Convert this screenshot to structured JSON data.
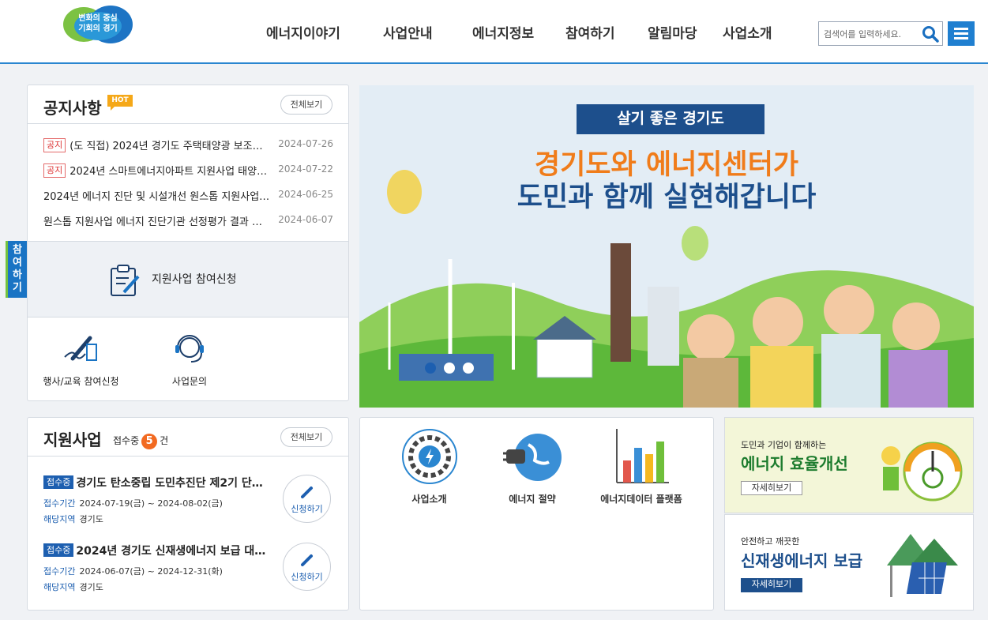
{
  "header": {
    "logo_line1": "변화의 중심",
    "logo_line2": "기회의 경기",
    "nav": [
      "에너지이야기",
      "사업안내",
      "에너지정보",
      "참여하기",
      "알림마당",
      "사업소개"
    ],
    "search_placeholder": "검색어를 입력하세요."
  },
  "side_tab": {
    "chars": [
      "참",
      "여",
      "하",
      "기"
    ]
  },
  "notice": {
    "title": "공지사항",
    "hot": "HOT",
    "more": "전체보기",
    "items": [
      {
        "tag": "공지",
        "text": "(도 직접) 2024년 경기도 주택태양광 보조…",
        "date": "2024-07-26"
      },
      {
        "tag": "공지",
        "text": "2024년 스마트에너지아파트 지원사업 태양…",
        "date": "2024-07-22"
      },
      {
        "tag": "",
        "text": "2024년 에너지 진단 및 시설개선 원스톱 지원사업…",
        "date": "2024-06-25"
      },
      {
        "tag": "",
        "text": "원스톱 지원사업 에너지 진단기관 선정평가 결과 …",
        "date": "2024-06-07"
      }
    ],
    "apply_big": "지원사업 참여신청",
    "quick": [
      "행사/교육 참여신청",
      "사업문의"
    ]
  },
  "banner": {
    "ribbon": "살기 좋은 경기도",
    "line1": "경기도와 에너지센터가",
    "line2": "도민과 함께 실현해갑니다",
    "colors": {
      "orange": "#f07c1a",
      "navy": "#1d4f8c"
    }
  },
  "support": {
    "title": "지원사업",
    "count_prefix": "접수중",
    "count": "5",
    "count_suffix": "건",
    "more": "전체보기",
    "items": [
      {
        "tag": "접수중",
        "title": "경기도 탄소중립 도민추진단 제2기 단…",
        "period_label": "접수기간",
        "period": "2024-07-19(금) ~ 2024-08-02(금)",
        "region_label": "해당지역",
        "region": "경기도",
        "apply": "신청하기"
      },
      {
        "tag": "접수중",
        "title": "2024년 경기도 신재생에너지 보급 대…",
        "period_label": "접수기간",
        "period": "2024-06-07(금) ~ 2024-12-31(화)",
        "region_label": "해당지역",
        "region": "경기도",
        "apply": "신청하기"
      }
    ]
  },
  "icons": {
    "items": [
      {
        "label": "사업소개",
        "icon": "gear-bolt-icon"
      },
      {
        "label": "에너지 절약",
        "icon": "plug-earth-icon"
      },
      {
        "label": "에너지데이터 플랫폼",
        "icon": "bar-chart-icon"
      }
    ]
  },
  "promos": [
    {
      "sub": "도민과 기업이 함께하는",
      "main": "에너지 효율개선",
      "btn": "자세히보기"
    },
    {
      "sub": "안전하고 깨끗한",
      "main": "신재생에너지 보급",
      "btn": "자세히보기"
    }
  ]
}
